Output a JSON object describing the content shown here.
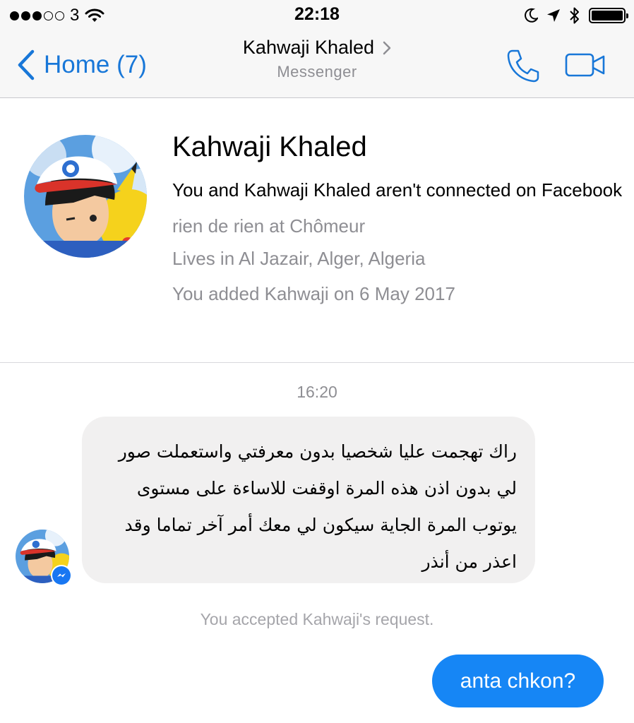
{
  "status_bar": {
    "carrier": "3",
    "time": "22:18",
    "icons": [
      "signal-dots-icon",
      "wifi-icon",
      "moon-icon",
      "location-arrow-icon",
      "bluetooth-icon",
      "battery-icon"
    ]
  },
  "nav": {
    "back_label": "Home (7)",
    "title": "Kahwaji Khaled",
    "subtitle": "Messenger",
    "accent_color": "#1877d8",
    "icons": [
      "chevron-left-icon",
      "chevron-right-icon",
      "phone-icon",
      "video-camera-icon"
    ]
  },
  "profile": {
    "name": "Kahwaji Khaled",
    "connection": "You and Kahwaji Khaled aren't connected on Facebook",
    "work": "rien de rien at Chômeur",
    "location": "Lives in Al Jazair, Alger, Algeria",
    "added": "You added Kahwaji on 6 May 2017"
  },
  "conversation": {
    "timestamp": "16:20",
    "incoming_message": "راك تهجمت عليا شخصيا بدون معرفتي واستعملت صور لي بدون اذن هذه المرة اوقفت للاساءة على مستوى يوتوب المرة الجاية سيكون لي معك أمر آخر تماما وقد اعذر من أنذر",
    "system_message": "You accepted Kahwaji's request.",
    "outgoing_message": "anta chkon?",
    "outgoing_color": "#1686f5"
  }
}
